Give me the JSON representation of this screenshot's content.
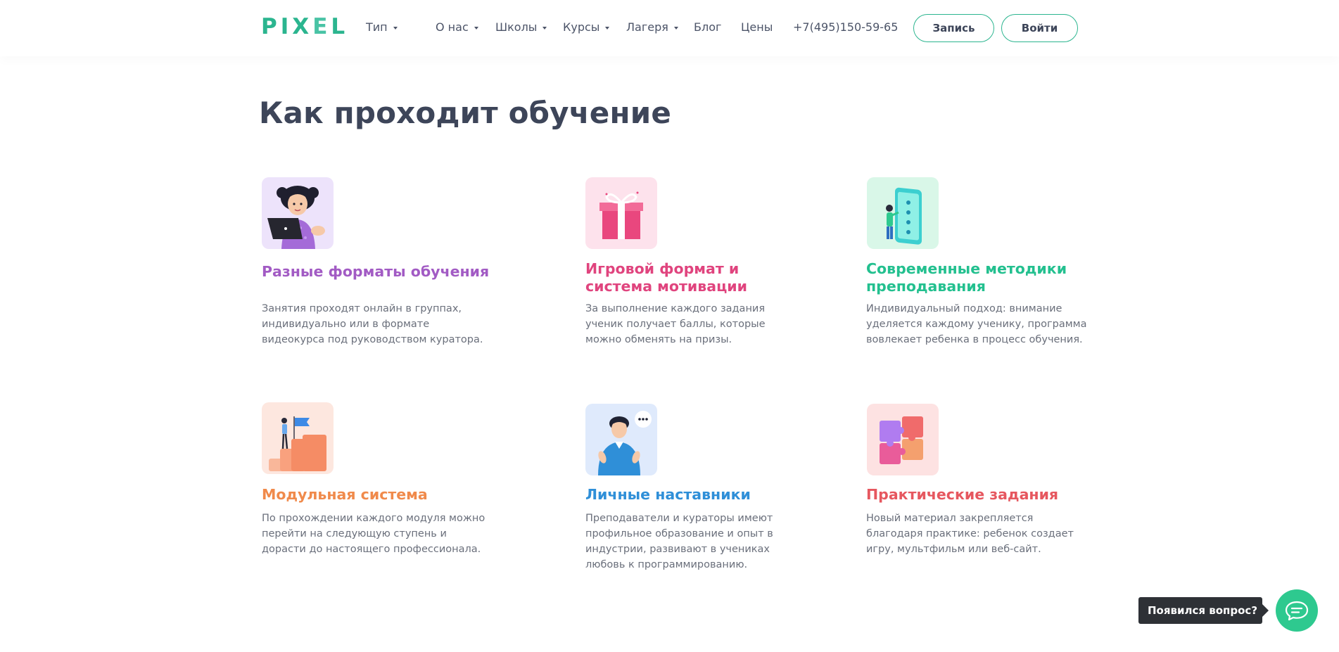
{
  "header": {
    "logo_letters": [
      "P",
      "I",
      "X",
      "E",
      "L"
    ],
    "logo_colors": [
      "#2bb58f",
      "#2bb58f",
      "#2bb58f",
      "#49c3a5",
      "#2bb58f"
    ],
    "nav": [
      {
        "label": "Тип",
        "dropdown": true
      },
      {
        "label": "О нас",
        "dropdown": true
      },
      {
        "label": "Школы",
        "dropdown": true
      },
      {
        "label": "Курсы",
        "dropdown": true
      },
      {
        "label": "Лагеря",
        "dropdown": true
      },
      {
        "label": "Блог",
        "dropdown": false
      },
      {
        "label": "Цены",
        "dropdown": false
      },
      {
        "label": "+7(495)150-59-65",
        "dropdown": false
      }
    ],
    "signup_label": "Запись",
    "login_label": "Войти",
    "accent_color": "#2bb58f"
  },
  "main": {
    "title": "Как проходит обучение",
    "cards": [
      {
        "title": "Разные форматы обучения",
        "text": "Занятия проходят онлайн в группах, индивидуально или в формате видеокурса под руководством куратора.",
        "color": "#a25bc4",
        "icon": "girl-with-laptop-icon"
      },
      {
        "title": "Игровой формат и система мотивации",
        "text": "За выполнение каждого задания ученик получает баллы, которые можно обменять на призы.",
        "color": "#e0447e",
        "icon": "gift-box-icon"
      },
      {
        "title": "Современные методики преподавания",
        "text": "Индивидуальный подход: внимание уделяется каждому ученику, программа вовлекает ребенка в процесс обучения.",
        "color": "#23c08f",
        "icon": "phone-checklist-icon"
      },
      {
        "title": "Модульная система",
        "text": "По прохождении каждого модуля можно перейти на следующую ступень и дорасти до настоящего профессионала.",
        "color": "#f08a4b",
        "icon": "stairs-flag-icon"
      },
      {
        "title": "Личные наставники",
        "text": "Преподаватели и кураторы имеют профильное образование и опыт в индустрии, развивают в учениках любовь к программированию.",
        "color": "#2f8fd8",
        "icon": "mentor-icon"
      },
      {
        "title": "Практические задания",
        "text": "Новый материал закрепляется благодаря практике: ребенок создает игру, мультфильм или веб-сайт.",
        "color": "#e6575f",
        "icon": "puzzle-icon"
      }
    ]
  },
  "chat": {
    "tooltip": "Появился вопрос?",
    "icon": "chat-bubble-icon",
    "color": "#2ec98f"
  }
}
